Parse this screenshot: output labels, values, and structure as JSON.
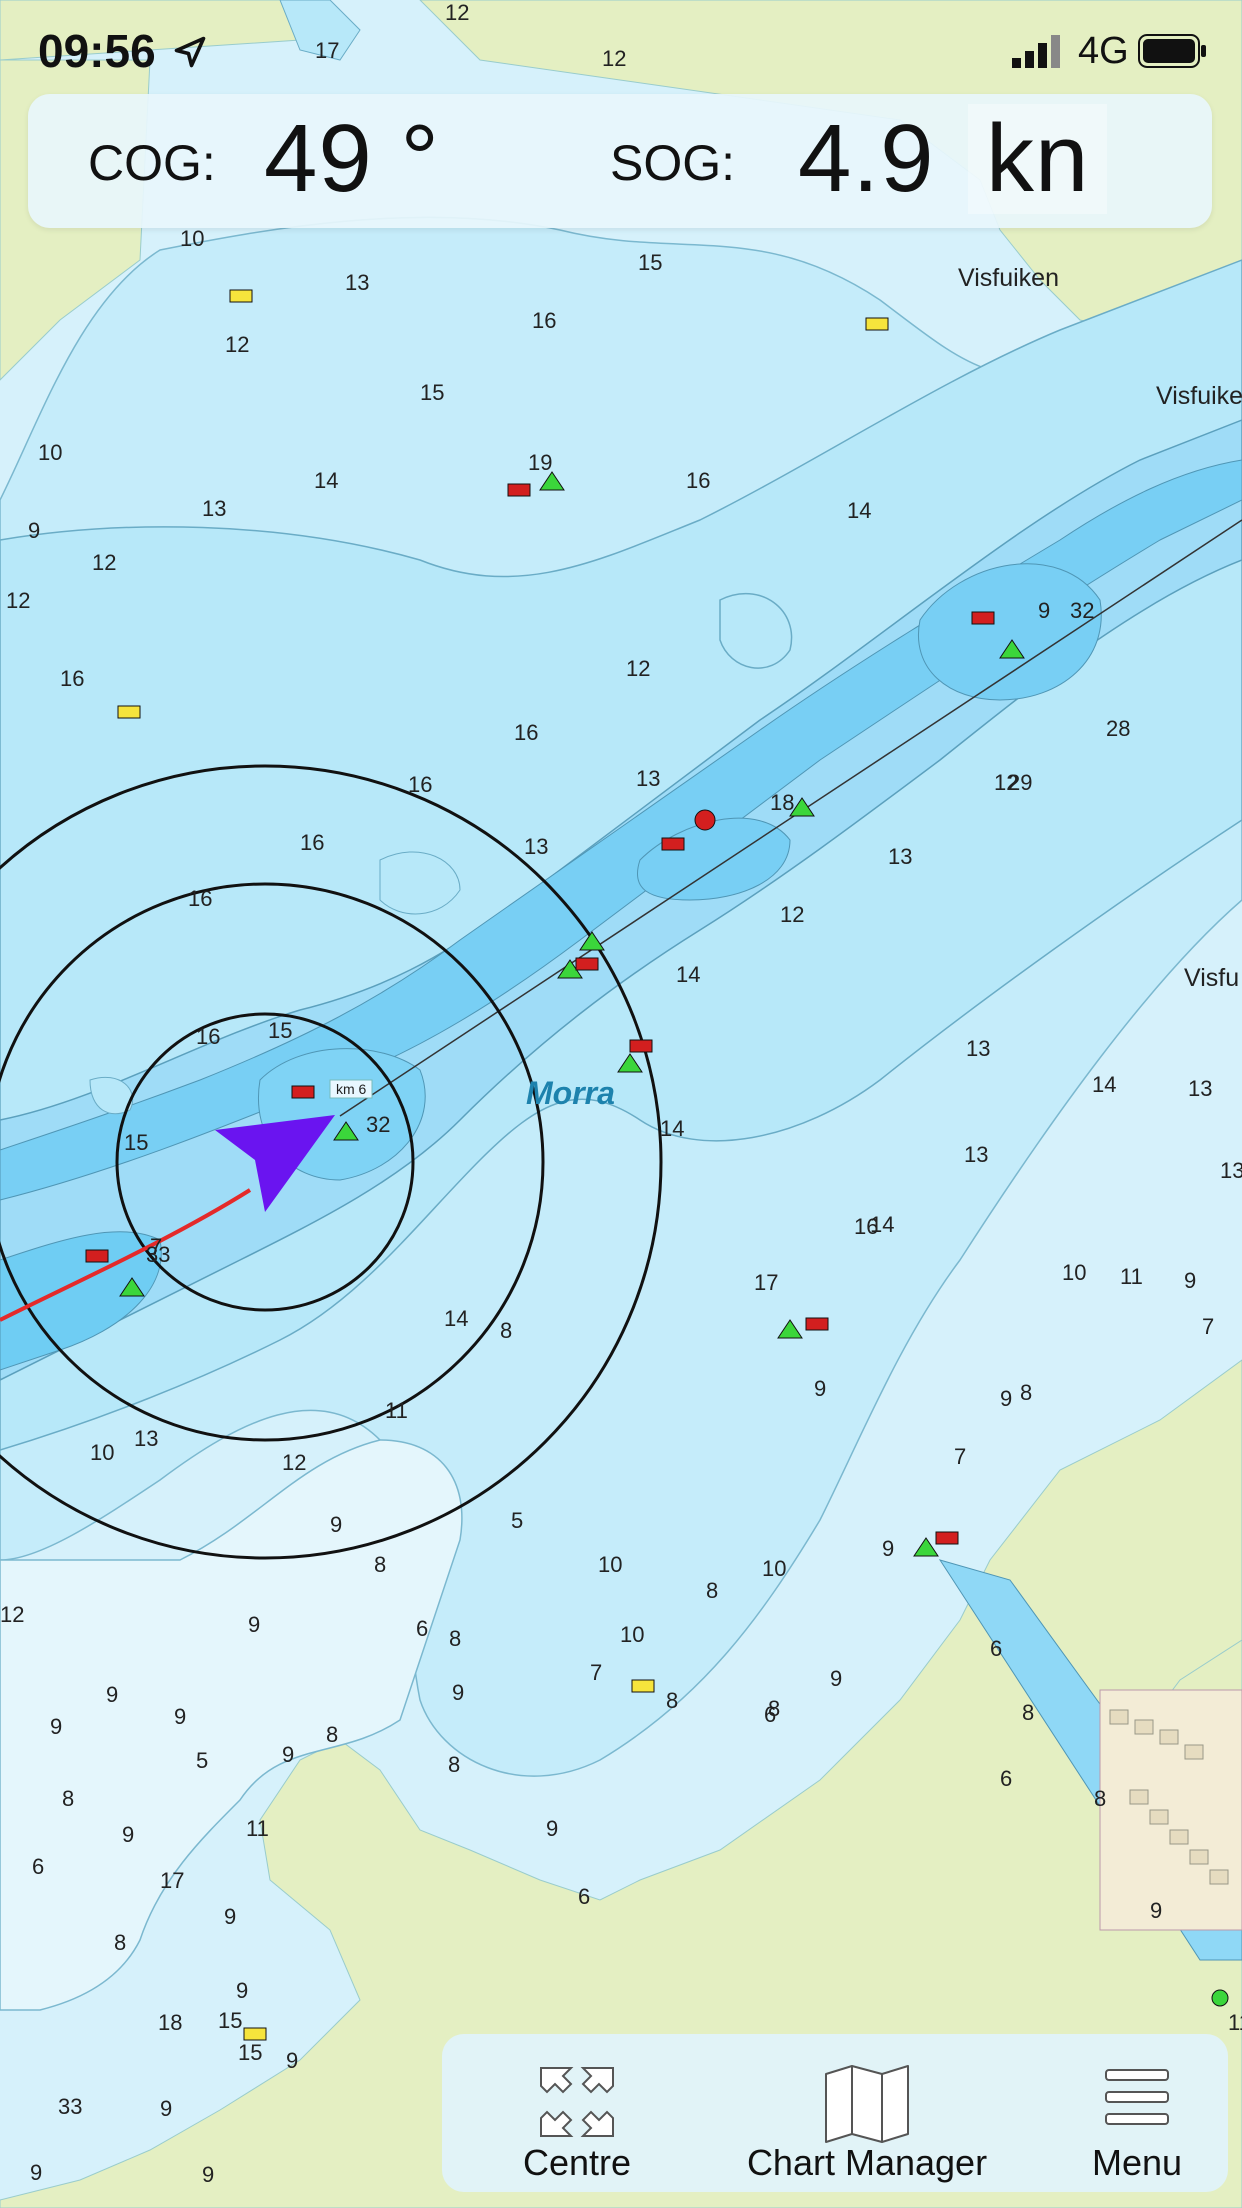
{
  "status_bar": {
    "time": "09:56",
    "network": "4G",
    "icons": [
      "location-arrow-icon",
      "signal-icon",
      "battery-icon"
    ]
  },
  "nav_display": {
    "cog_label": "COG:",
    "cog_value": "49 °",
    "sog_label": "SOG:",
    "sog_value": "4.9",
    "sog_unit": "kn"
  },
  "map": {
    "area_label": "Morra",
    "km_marker": "km 6",
    "place_labels": [
      "Visfuiken",
      "Visfuike",
      "Visfu"
    ],
    "depth_soundings": [
      "12",
      "17",
      "12",
      "10",
      "15",
      "13",
      "16",
      "12",
      "15",
      "10",
      "19",
      "16",
      "13",
      "9",
      "12",
      "14",
      "14",
      "32",
      "9",
      "12",
      "16",
      "12",
      "16",
      "28",
      "12",
      "13",
      "18",
      "29",
      "13",
      "16",
      "16",
      "16",
      "13",
      "14",
      "12",
      "16",
      "13",
      "14",
      "14",
      "13",
      "13",
      "15",
      "32",
      "13",
      "33",
      "14",
      "15",
      "17",
      "14",
      "10",
      "9",
      "11",
      "10",
      "8",
      "16",
      "9",
      "13",
      "12",
      "11",
      "9",
      "5",
      "8",
      "10",
      "10",
      "9",
      "7",
      "12",
      "9",
      "6",
      "9",
      "8",
      "10",
      "9",
      "6",
      "8",
      "8",
      "8",
      "7",
      "6",
      "9",
      "8",
      "9",
      "8",
      "9",
      "9",
      "9",
      "5",
      "7",
      "8",
      "11",
      "9",
      "6",
      "9",
      "9",
      "9",
      "6",
      "8",
      "9",
      "17",
      "15",
      "18",
      "15",
      "33",
      "8",
      "9",
      "9",
      "9",
      "6",
      "8",
      "9",
      "11",
      "7",
      "8"
    ],
    "colors": {
      "land": "#e4efc2",
      "shallow_water": "#d6f1fb",
      "mid_water": "#b7e8f9",
      "deep_water": "#8fd8f6",
      "fairway": "#6fcdf3",
      "vessel_arrow": "#6a14f0",
      "track_line": "#e42a2a",
      "buoy_red": "#d31f1f",
      "buoy_green": "#3bd63b",
      "mooring_yellow": "#f6e43c"
    }
  },
  "toolbar": {
    "centre_label": "Centre",
    "chart_manager_label": "Chart Manager",
    "menu_label": "Menu"
  }
}
